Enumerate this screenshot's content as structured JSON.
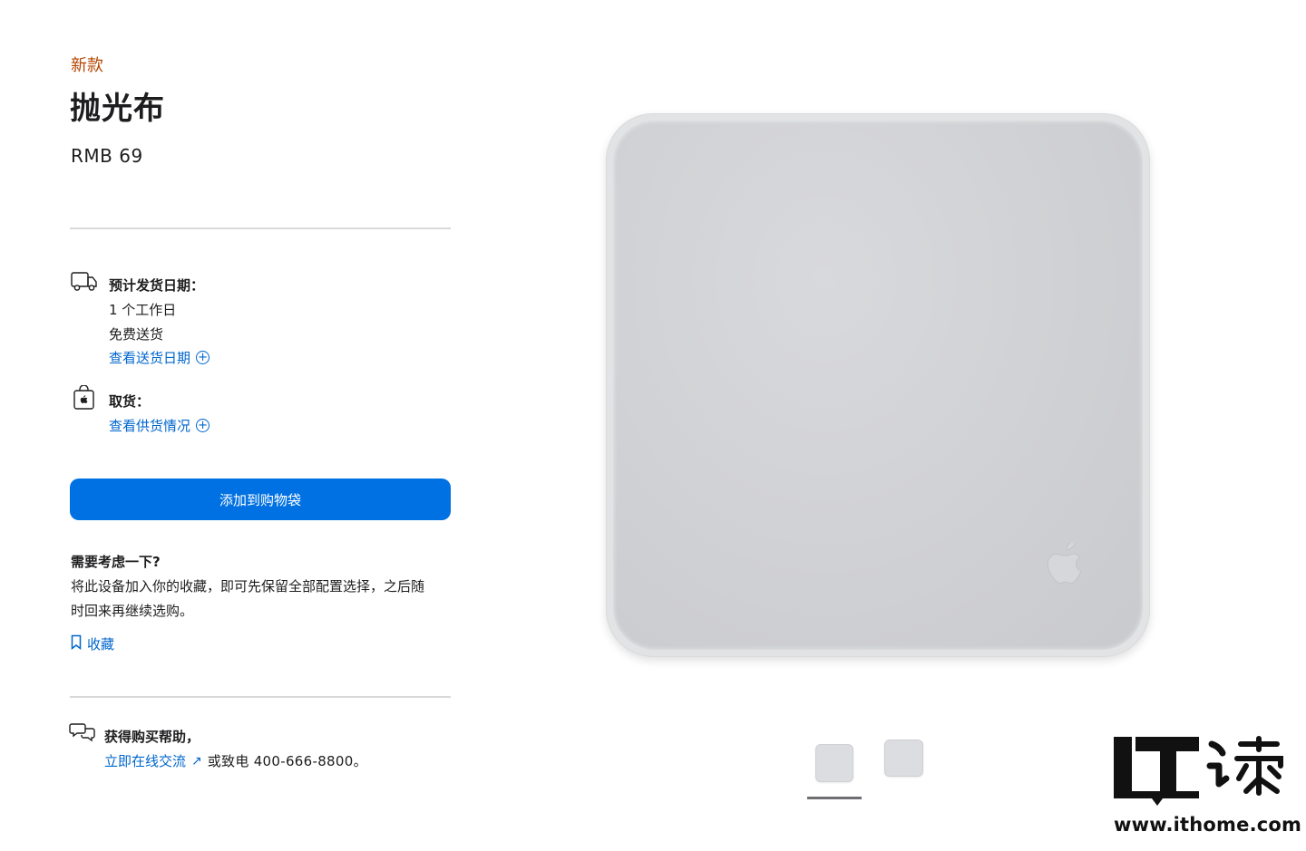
{
  "product": {
    "badge": "新款",
    "title": "抛光布",
    "price": "RMB 69"
  },
  "shipping": {
    "label": "预计发货日期：",
    "days": "1 个工作日",
    "free": "免费送货",
    "link": "查看送货日期"
  },
  "pickup": {
    "label": "取货：",
    "link": "查看供货情况"
  },
  "cart": {
    "button": "添加到购物袋"
  },
  "consider": {
    "title": "需要考虑一下?",
    "body": "将此设备加入你的收藏，即可先保留全部配置选择，之后随时回来再继续选购。",
    "save_link": "收藏"
  },
  "help": {
    "title": "获得购买帮助，",
    "live_link": "立即在线交流",
    "call": "或致电 400-666-8800。"
  },
  "gallery": {
    "thumbnails": [
      "thumbnail-front",
      "thumbnail-angle"
    ],
    "selected_index": 0
  },
  "watermark": {
    "url": "www.ithome.com"
  },
  "colors": {
    "accent_link": "#0066cc",
    "button_blue": "#0071e3",
    "new_badge": "#b64400"
  }
}
